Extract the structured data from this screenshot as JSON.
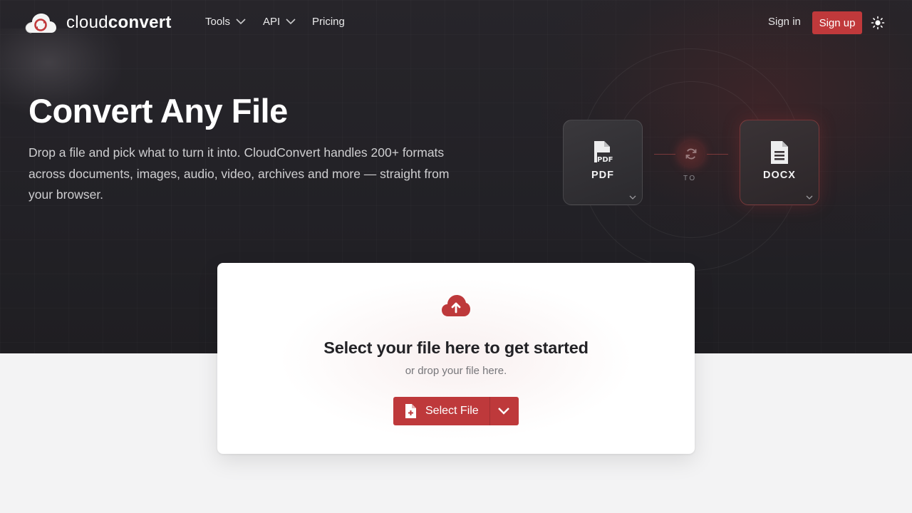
{
  "header": {
    "logo": {
      "text_light": "cloud",
      "text_bold": "convert",
      "icon": "cloud-logo-icon"
    },
    "nav": [
      {
        "label": "Tools",
        "has_dropdown": true
      },
      {
        "label": "API",
        "has_dropdown": true
      },
      {
        "label": "Pricing",
        "has_dropdown": false
      }
    ],
    "sign_in": "Sign in",
    "sign_up": "Sign up",
    "theme_icon": "sun-icon"
  },
  "hero": {
    "title": "Convert Any File",
    "description": "Drop a file and pick what to turn it into. CloudConvert handles 200+ formats across documents, images, audio, video, archives and more — straight from your browser."
  },
  "converter": {
    "source": {
      "label": "PDF",
      "icon": "pdf-file-icon"
    },
    "connector_label": "TO",
    "target": {
      "label": "DOCX",
      "icon": "document-file-icon"
    }
  },
  "upload": {
    "icon": "cloud-upload-icon",
    "title": "Select your file here to get started",
    "subtitle": "or drop your file here.",
    "button_label": "Select File"
  },
  "colors": {
    "accent": "#be393b",
    "hero_bg": "#242327",
    "page_bg": "#f3f3f4"
  }
}
